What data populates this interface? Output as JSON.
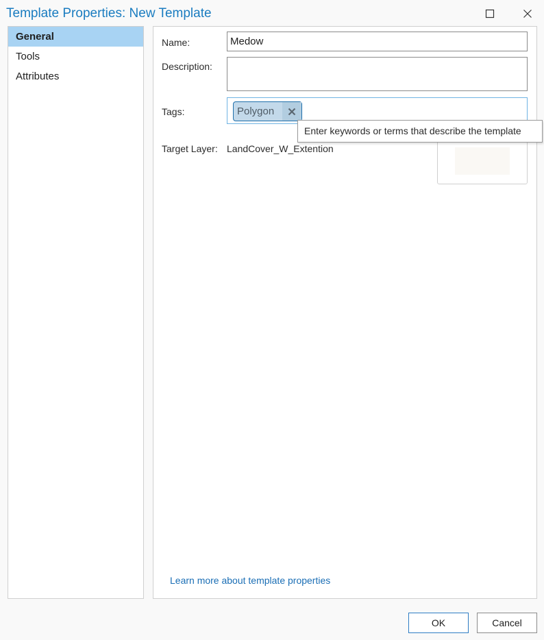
{
  "window": {
    "title": "Template Properties: New Template"
  },
  "sidebar": {
    "items": [
      {
        "label": "General",
        "selected": true
      },
      {
        "label": "Tools",
        "selected": false
      },
      {
        "label": "Attributes",
        "selected": false
      }
    ]
  },
  "general": {
    "name_label": "Name:",
    "name_value": "Medow",
    "description_label": "Description:",
    "description_value": "",
    "tags_label": "Tags:",
    "tags": [
      "Polygon"
    ],
    "target_layer_label": "Target Layer:",
    "target_layer_value": "LandCover_W_Extention",
    "tooltip": "Enter keywords or terms that describe the template",
    "learn_more_link": "Learn more about template properties"
  },
  "footer": {
    "ok_label": "OK",
    "cancel_label": "Cancel"
  },
  "colors": {
    "title": "#1a7cc0",
    "selected_nav": "#a8d3f3",
    "link": "#1a6eb5",
    "tag_chip": "#c3d9ea"
  },
  "icons": {
    "maximize": "maximize-icon",
    "close": "close-icon",
    "tag_remove": "tag-remove-icon"
  }
}
